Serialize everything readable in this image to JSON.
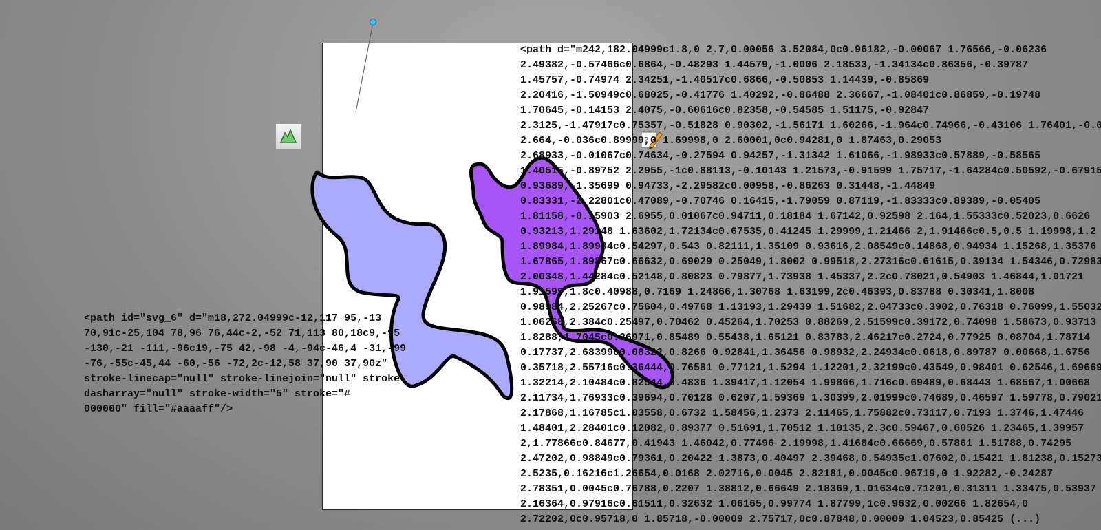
{
  "colors": {
    "blob_fill": "#aaaaff",
    "purple_fill": "#a855f7",
    "stroke": "#000000",
    "handle": "#33c4ff"
  },
  "tools": {
    "shape_tool_icon": "shape-library-icon",
    "edit_icon": "pencil-edit-icon"
  },
  "left_code": "<path id=\"svg_6\" d=\"m18,272.04999c-12,117 95,-13\n70,91c-25,104 78,96 76,44c-2,-52 71,113 80,18c9,-95\n-130,-21 -111,-96c19,-75 42,-98 -4,-94c-46,4 -31,-99\n-76,-55c-45,44 -60,-56 -72,2c-12,58 37,90 37,90z\"\nstroke-linecap=\"null\" stroke-linejoin=\"null\" stroke-\ndasharray=\"null\" stroke-width=\"5\" stroke=\"#\n000000\" fill=\"#aaaaff\"/>",
  "right_code": "<path d=\"m242,182.04999c1.8,0 2.7,0.00056 3.52084,0c0.96182,-0.00067 1.76566,-0.06236\n2.49382,-0.57466c0.6864,-0.48293 1.44579,-1.0006 2.18533,-1.34134c0.86356,-0.39787\n1.45757,-0.74974 2.34251,-1.40517c0.6866,-0.50853 1.14439,-0.85869\n2.20416,-1.50949c0.68025,-0.41776 1.40292,-0.86488 2.36667,-1.08401c0.86859,-0.19748\n1.70645,-0.14153 2.4075,-0.60616c0.82358,-0.54585 1.51175,-0.92847\n2.3125,-1.47917c0.75357,-0.51828 0.90302,-1.56171 1.60266,-1.964c0.74966,-0.43106 1.76401,-0.036\n2.664,-0.036c0.89999,0 1.69998,0 2.60001,0c0.94281,0 1.87463,0.29053\n2.68933,-0.01067c0.74634,-0.27594 0.94257,-1.31342 1.61066,-1.98933c0.57889,-0.58565\n1.40515,-0.89752 2.2955,-1c0.88113,-0.10143 1.21573,-0.91599 1.75717,-1.64284c0.50592,-0.67915\n0.93689,-1.35699 0.94733,-2.29582c0.00958,-0.86263 0.31448,-1.44849\n0.83331,-2.22801c0.47089,-0.70746 0.16415,-1.79059 0.87119,-1.83333c0.89389,-0.05405\n1.81158,-0.15903 2.6955,0.01067c0.94711,0.18184 1.67142,0.92598 2.164,1.55333c0.52023,0.6626\n0.93213,1.29148 1.63602,1.72134c0.67535,0.41245 1.29999,1.21466 2,1.91466c0.5,0.5 1.19998,1.2\n1.89984,1.89984c0.54297,0.543 0.82111,1.35109 0.93616,2.08549c0.14868,0.94934 1.15268,1.35376\n1.67865,1.89867c0.66632,0.69029 0.25049,1.8002 0.99518,2.27316c0.61615,0.39134 1.54346,0.72983\n2.00348,1.44284c0.52148,0.80823 0.79877,1.73938 1.45337,2.2c0.78021,0.54903 1.46844,1.01721\n1.91599,1.8c0.40988,0.7169 1.24866,1.30768 1.63199,2c0.46393,0.83788 0.30341,1.8008\n0.98984,2.25267c0.75604,0.49768 1.13193,1.29439 1.51682,2.04733c0.3902,0.76318 0.76099,1.55032\n1.06268,2.384c0.25497,0.70462 0.45264,1.70253 0.88269,2.51599c0.39172,0.74098 1.58673,0.93713\n1.8288,1.7045c0.26971,0.85489 0.55438,1.65121 0.83783,2.46217c0.2724,0.77925 0.08704,1.78714\n0.17737,2.68399c0.08322,0.8266 0.92841,1.36456 0.98932,2.24934c0.0618,0.89787 0.00668,1.6756\n0.35718,2.55716c0.36444,0.76581 0.77121,1.5294 1.12201,2.32199c0.43549,0.98401 0.62546,1.69669\n1.32214,2.10484c0.82544,0.4836 1.39417,1.12054 1.99866,1.716c0.69489,0.68443 1.68567,1.00668\n2.11734,1.76933c0.39694,0.70128 0.6207,1.59369 1.30399,2.01999c0.74689,0.46597 1.59778,0.79021\n2.17868,1.16785c1.03558,0.6732 1.58456,1.2373 2.11465,1.75882c0.73117,0.7193 1.3746,1.47446\n1.48401,2.28401c0.12082,0.89377 0.51691,1.70512 1.10135,2.3c0.59467,0.60526 1.23465,1.39957\n2,1.77866c0.84677,0.41943 1.46042,0.77496 2.19998,1.41684c0.66669,0.57861 1.51788,0.74295\n2.47202,0.98849c0.79361,0.20422 1.3873,0.40497 2.39468,0.54935c1.07602,0.15421 1.81238,0.15273\n2.5235,0.16216c1.26654,0.0168 2.02716,0.0045 2.82181,0.0045c0.96719,0 1.92282,-0.24287\n2.78351,0.0045c0.76788,0.2207 1.38812,0.66649 2.18369,1.01634c0.71201,0.31311 1.33475,0.53937\n2.16364,0.97916c0.61511,0.32632 1.06165,0.99774 1.87799,1c0.9632,0.00266 1.82654,0\n2.72202,0c0.95718,0 1.85718,-0.00009 2.75717,0c0.87848,0.00009 1.04523,0.85425 (...)"
}
